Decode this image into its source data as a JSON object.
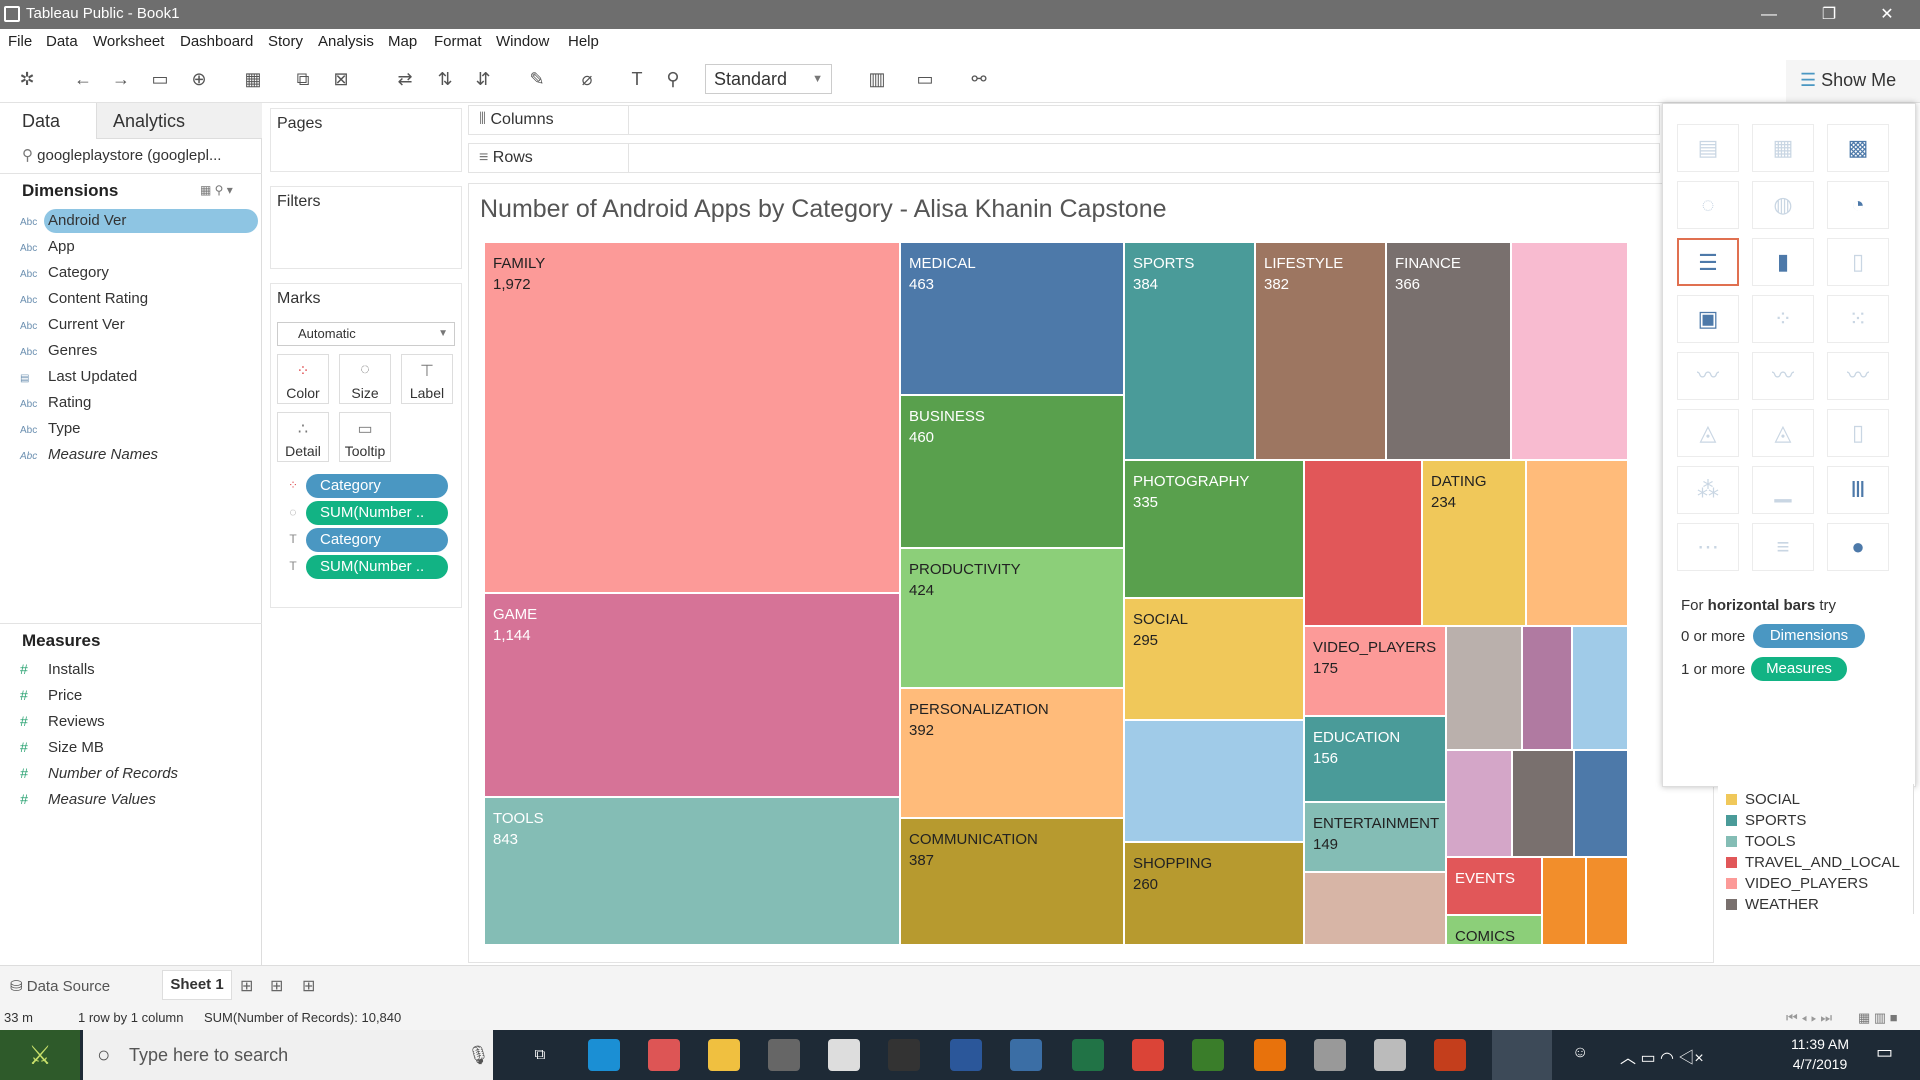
{
  "window": {
    "title": "Tableau Public - Book1",
    "controls": [
      "—",
      "❐",
      "✕"
    ]
  },
  "menu": [
    "File",
    "Data",
    "Worksheet",
    "Dashboard",
    "Story",
    "Analysis",
    "Map",
    "Format",
    "Window",
    "Help"
  ],
  "toolbar": {
    "fit_select": "Standard",
    "show_me": "Show Me"
  },
  "data_pane": {
    "tabs": [
      "Data",
      "Analytics"
    ],
    "datasource": "googleplaystore (googlepl...",
    "dimensions_title": "Dimensions",
    "dimensions": [
      "Android Ver",
      "App",
      "Category",
      "Content Rating",
      "Current Ver",
      "Genres",
      "Last Updated",
      "Rating",
      "Type",
      "Measure Names"
    ],
    "measures_title": "Measures",
    "measures": [
      "Installs",
      "Price",
      "Reviews",
      "Size MB",
      "Number of Records",
      "Measure Values"
    ]
  },
  "cards": {
    "pages": "Pages",
    "filters": "Filters",
    "marks": "Marks",
    "mark_type": "Automatic",
    "mark_buttons": [
      "Color",
      "Size",
      "Label",
      "Detail",
      "Tooltip"
    ],
    "pills": [
      "Category",
      "SUM(Number ..",
      "Category",
      "SUM(Number .."
    ]
  },
  "shelves": {
    "columns": "Columns",
    "rows": "Rows"
  },
  "viz": {
    "title": "Number of Android Apps by Category - Alisa Khanin Capstone"
  },
  "treemap": [
    {
      "label": "FAMILY",
      "value": "1,972",
      "color": "#fc9a98"
    },
    {
      "label": "GAME",
      "value": "1,144",
      "color": "#d67397"
    },
    {
      "label": "TOOLS",
      "value": "843",
      "color": "#84bdb5"
    },
    {
      "label": "MEDICAL",
      "value": "463",
      "color": "#4d79a9"
    },
    {
      "label": "BUSINESS",
      "value": "460",
      "color": "#59a04d"
    },
    {
      "label": "PRODUCTIVITY",
      "value": "424",
      "color": "#8ccf79"
    },
    {
      "label": "PERSONALIZATION",
      "value": "392",
      "color": "#ffbb7a"
    },
    {
      "label": "COMMUNICATION",
      "value": "387",
      "color": "#b79a2f"
    },
    {
      "label": "SPORTS",
      "value": "384",
      "color": "#4a9b99"
    },
    {
      "label": "LIFESTYLE",
      "value": "382",
      "color": "#9d7661"
    },
    {
      "label": "FINANCE",
      "value": "366",
      "color": "#79706e"
    },
    {
      "label": "PHOTOGRAPHY",
      "value": "335",
      "color": "#59a04d"
    },
    {
      "label": "DATING",
      "value": "234",
      "color": "#f0c85a"
    },
    {
      "label": "SOCIAL",
      "value": "295",
      "color": "#f0c85a"
    },
    {
      "label": "VIDEO_PLAYERS",
      "value": "175",
      "color": "#fc9a98"
    },
    {
      "label": "EDUCATION",
      "value": "156",
      "color": "#4a9b99"
    },
    {
      "label": "ENTERTAINMENT",
      "value": "149",
      "color": "#84bdb5"
    },
    {
      "label": "SHOPPING",
      "value": "260",
      "color": "#b79a2f"
    },
    {
      "label": "EVENTS",
      "value": "",
      "color": "#e15759"
    },
    {
      "label": "COMICS",
      "value": "",
      "color": "#8ccf79"
    }
  ],
  "show_me": {
    "hint_prefix": "For ",
    "hint_bold": "horizontal bars",
    "hint_suffix": " try",
    "dims_req": "0 or more",
    "dims_pill": "Dimensions",
    "meas_req": "1 or more",
    "meas_pill": "Measures"
  },
  "legend": [
    {
      "label": "SOCIAL",
      "color": "#f0c85a"
    },
    {
      "label": "SPORTS",
      "color": "#4a9b99"
    },
    {
      "label": "TOOLS",
      "color": "#84bdb5"
    },
    {
      "label": "TRAVEL_AND_LOCAL",
      "color": "#e15759"
    },
    {
      "label": "VIDEO_PLAYERS",
      "color": "#fc9a98"
    },
    {
      "label": "WEATHER",
      "color": "#79706e"
    }
  ],
  "sheets": {
    "datasource_tab": "Data Source",
    "sheet_tab": "Sheet 1"
  },
  "status": {
    "marks": "33 m",
    "dims": "1 row by 1 column",
    "sum": "SUM(Number of Records): 10,840"
  },
  "taskbar": {
    "search": "Type here to search",
    "time": "11:39 AM",
    "date": "4/7/2019"
  }
}
